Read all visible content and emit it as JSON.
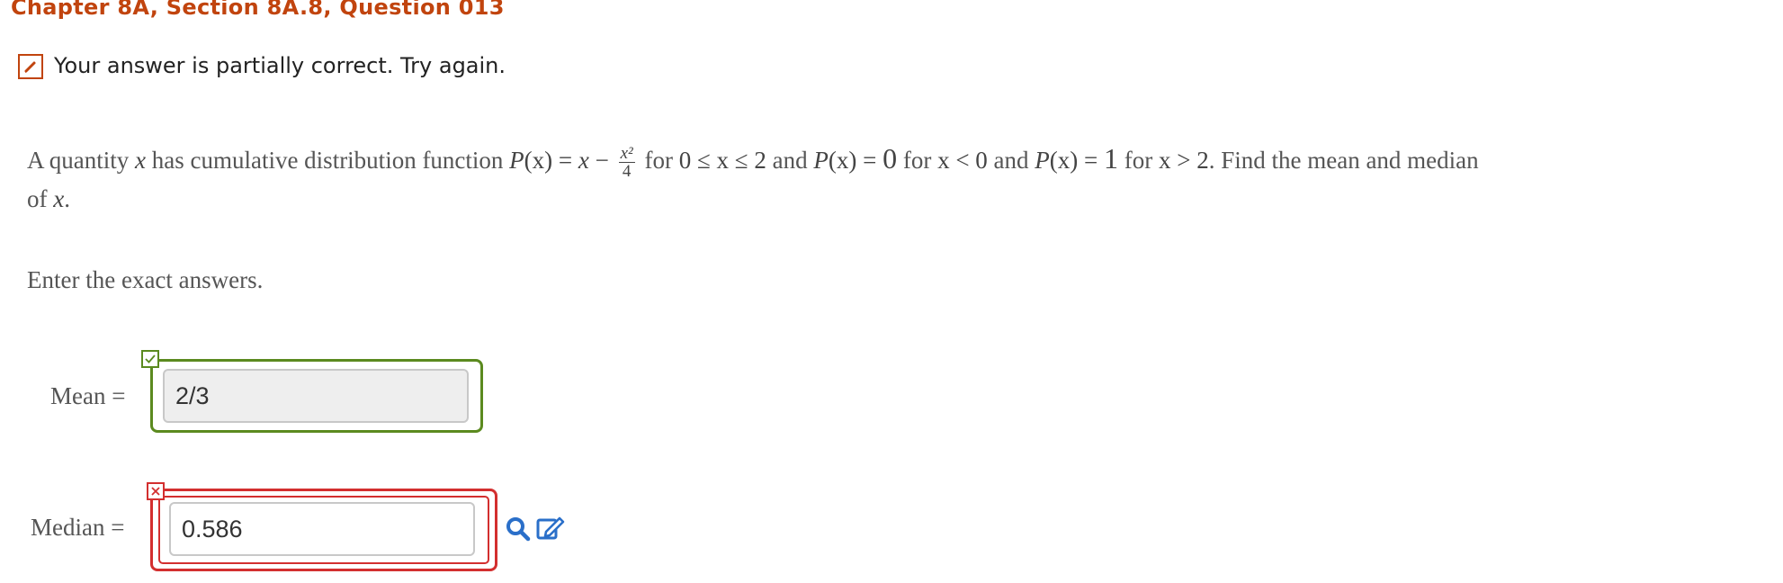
{
  "header": {
    "chapter_title": "Chapter 8A, Section 8A.8, Question 013"
  },
  "status": {
    "message": "Your answer is partially correct.  Try again.",
    "color": "#c1440e",
    "icon": "pencil-icon"
  },
  "question": {
    "intro": "A quantity",
    "var_x": "x",
    "has_cdf": "has cumulative distribution function",
    "P": "P",
    "paren_x": "(x)",
    "eq": "=",
    "x": "x",
    "minus": "−",
    "frac_num": "x²",
    "frac_den": "4",
    "for1": "for",
    "range1": "0 ≤ x ≤ 2",
    "and1": "and",
    "zero": "0",
    "for2": "for",
    "cond2": "x < 0",
    "and2": "and",
    "one": "1",
    "for3": "for",
    "cond3": "x > 2",
    "dot": ".",
    "find": "Find the mean and median",
    "of": "of",
    "x_end": "x",
    "period": "."
  },
  "instruction": "Enter the exact answers.",
  "answers": {
    "mean_label": "Mean =",
    "mean_value": "2/3",
    "mean_status": "correct",
    "median_label": "Median =",
    "median_value": "0.586",
    "median_status": "incorrect"
  },
  "tools": {
    "search": "search-icon",
    "edit": "edit-icon"
  },
  "colors": {
    "correct": "#5b8a1f",
    "incorrect": "#d32f2f",
    "accent": "#c1440e",
    "tool": "#2a6fc9"
  }
}
